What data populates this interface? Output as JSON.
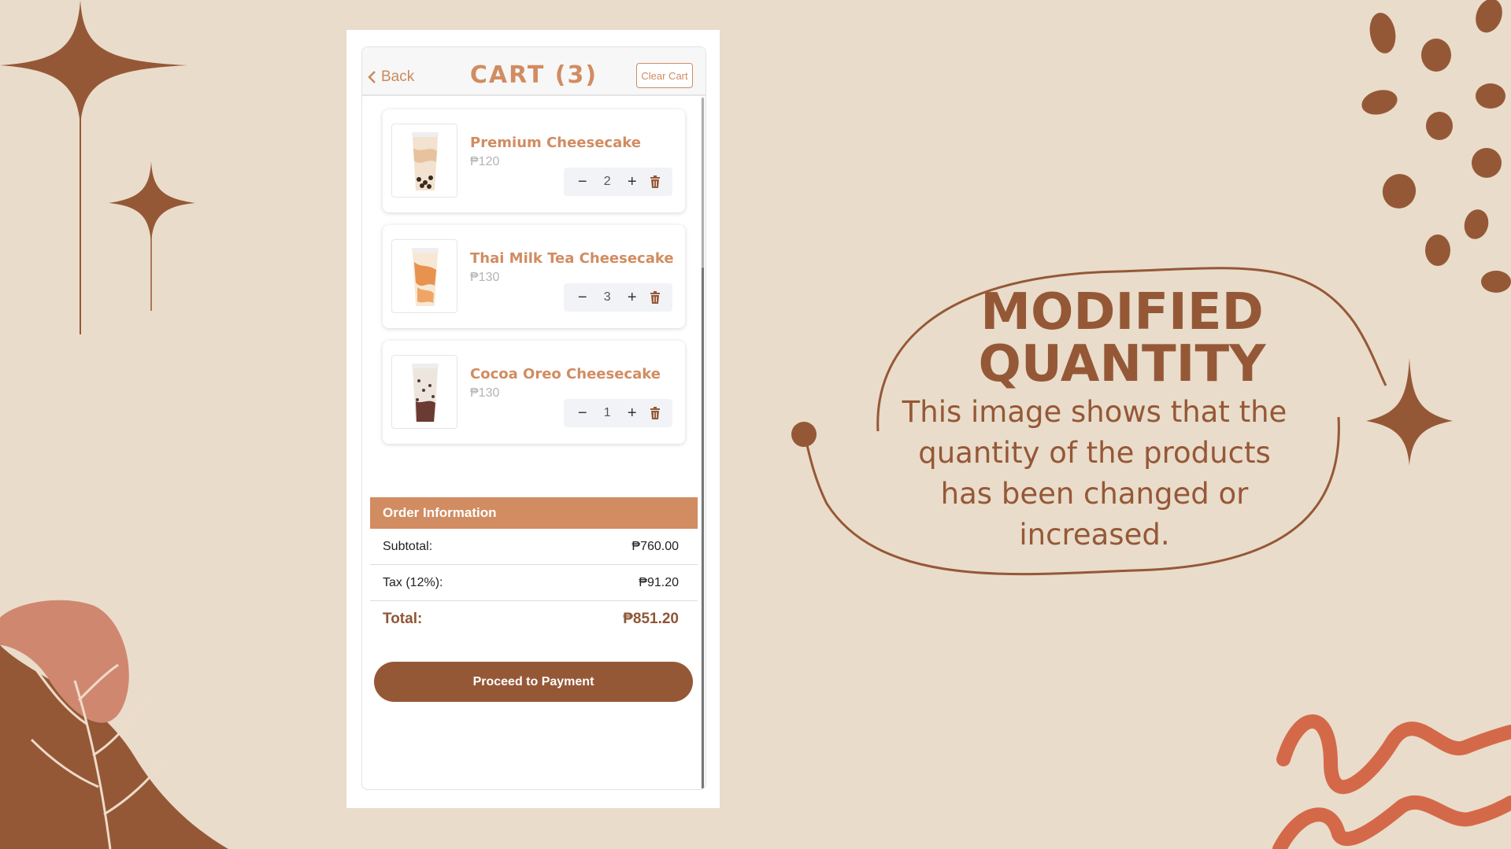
{
  "cart": {
    "back_label": "Back",
    "title": "CART (3)",
    "clear_label": "Clear Cart"
  },
  "items": [
    {
      "name": "Premium Cheesecake",
      "price": "₱120",
      "qty": "2",
      "drink": "pearl"
    },
    {
      "name": "Thai Milk Tea Cheesecake",
      "price": "₱130",
      "qty": "3",
      "drink": "thai"
    },
    {
      "name": "Cocoa Oreo Cheesecake",
      "price": "₱130",
      "qty": "1",
      "drink": "oreo"
    }
  ],
  "order": {
    "heading": "Order Information",
    "subtotal_label": "Subtotal:",
    "subtotal_value": "₱760.00",
    "tax_label": "Tax (12%):",
    "tax_value": "₱91.20",
    "total_label": "Total:",
    "total_value": "₱851.20",
    "pay_label": "Proceed to Payment"
  },
  "slide": {
    "heading_line1": "MODIFIED",
    "heading_line2": "QUANTITY",
    "description": "This image shows that the quantity of the products has been changed or increased."
  },
  "colors": {
    "background": "#e9dcca",
    "brown": "#955837",
    "accent": "#d18c61",
    "terracotta": "#d4694a"
  },
  "icons": {
    "back": "chevron-left-icon",
    "minus": "minus-icon",
    "plus": "plus-icon",
    "trash": "trash-icon"
  }
}
